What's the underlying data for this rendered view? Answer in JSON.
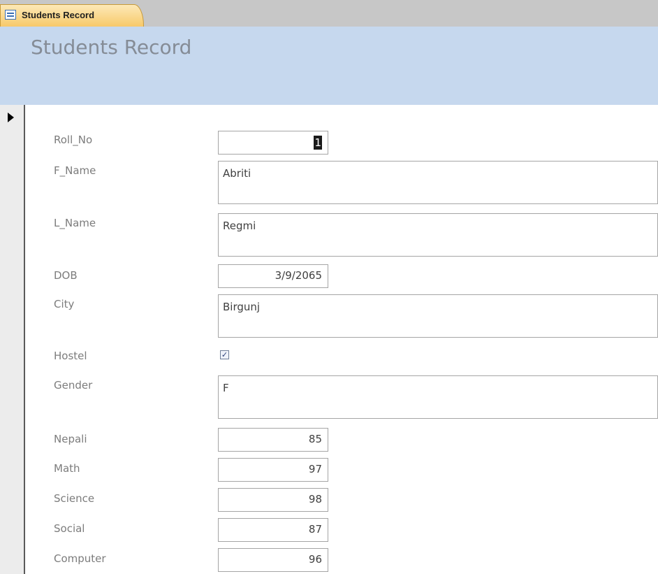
{
  "tab": {
    "label": "Students Record",
    "icon": "form-icon"
  },
  "form": {
    "title": "Students Record"
  },
  "record_selector": {
    "icon": "current-record-pointer-icon"
  },
  "fields": {
    "roll_no": {
      "label": "Roll_No",
      "value": "1"
    },
    "f_name": {
      "label": "F_Name",
      "value": "Abriti"
    },
    "l_name": {
      "label": "L_Name",
      "value": "Regmi"
    },
    "dob": {
      "label": "DOB",
      "value": "3/9/2065"
    },
    "city": {
      "label": "City",
      "value": "Birgunj"
    },
    "hostel": {
      "label": "Hostel",
      "checked": true,
      "mark": "✓"
    },
    "gender": {
      "label": "Gender",
      "value": "F"
    },
    "nepali": {
      "label": "Nepali",
      "value": "85"
    },
    "math": {
      "label": "Math",
      "value": "97"
    },
    "science": {
      "label": "Science",
      "value": "98"
    },
    "social": {
      "label": "Social",
      "value": "87"
    },
    "computer": {
      "label": "Computer",
      "value": "96"
    }
  },
  "colors": {
    "header_band": "#c6d8ee",
    "title_text": "#858c96",
    "label_text": "#7c7c7c",
    "tab_fill": "#f7c96a"
  }
}
